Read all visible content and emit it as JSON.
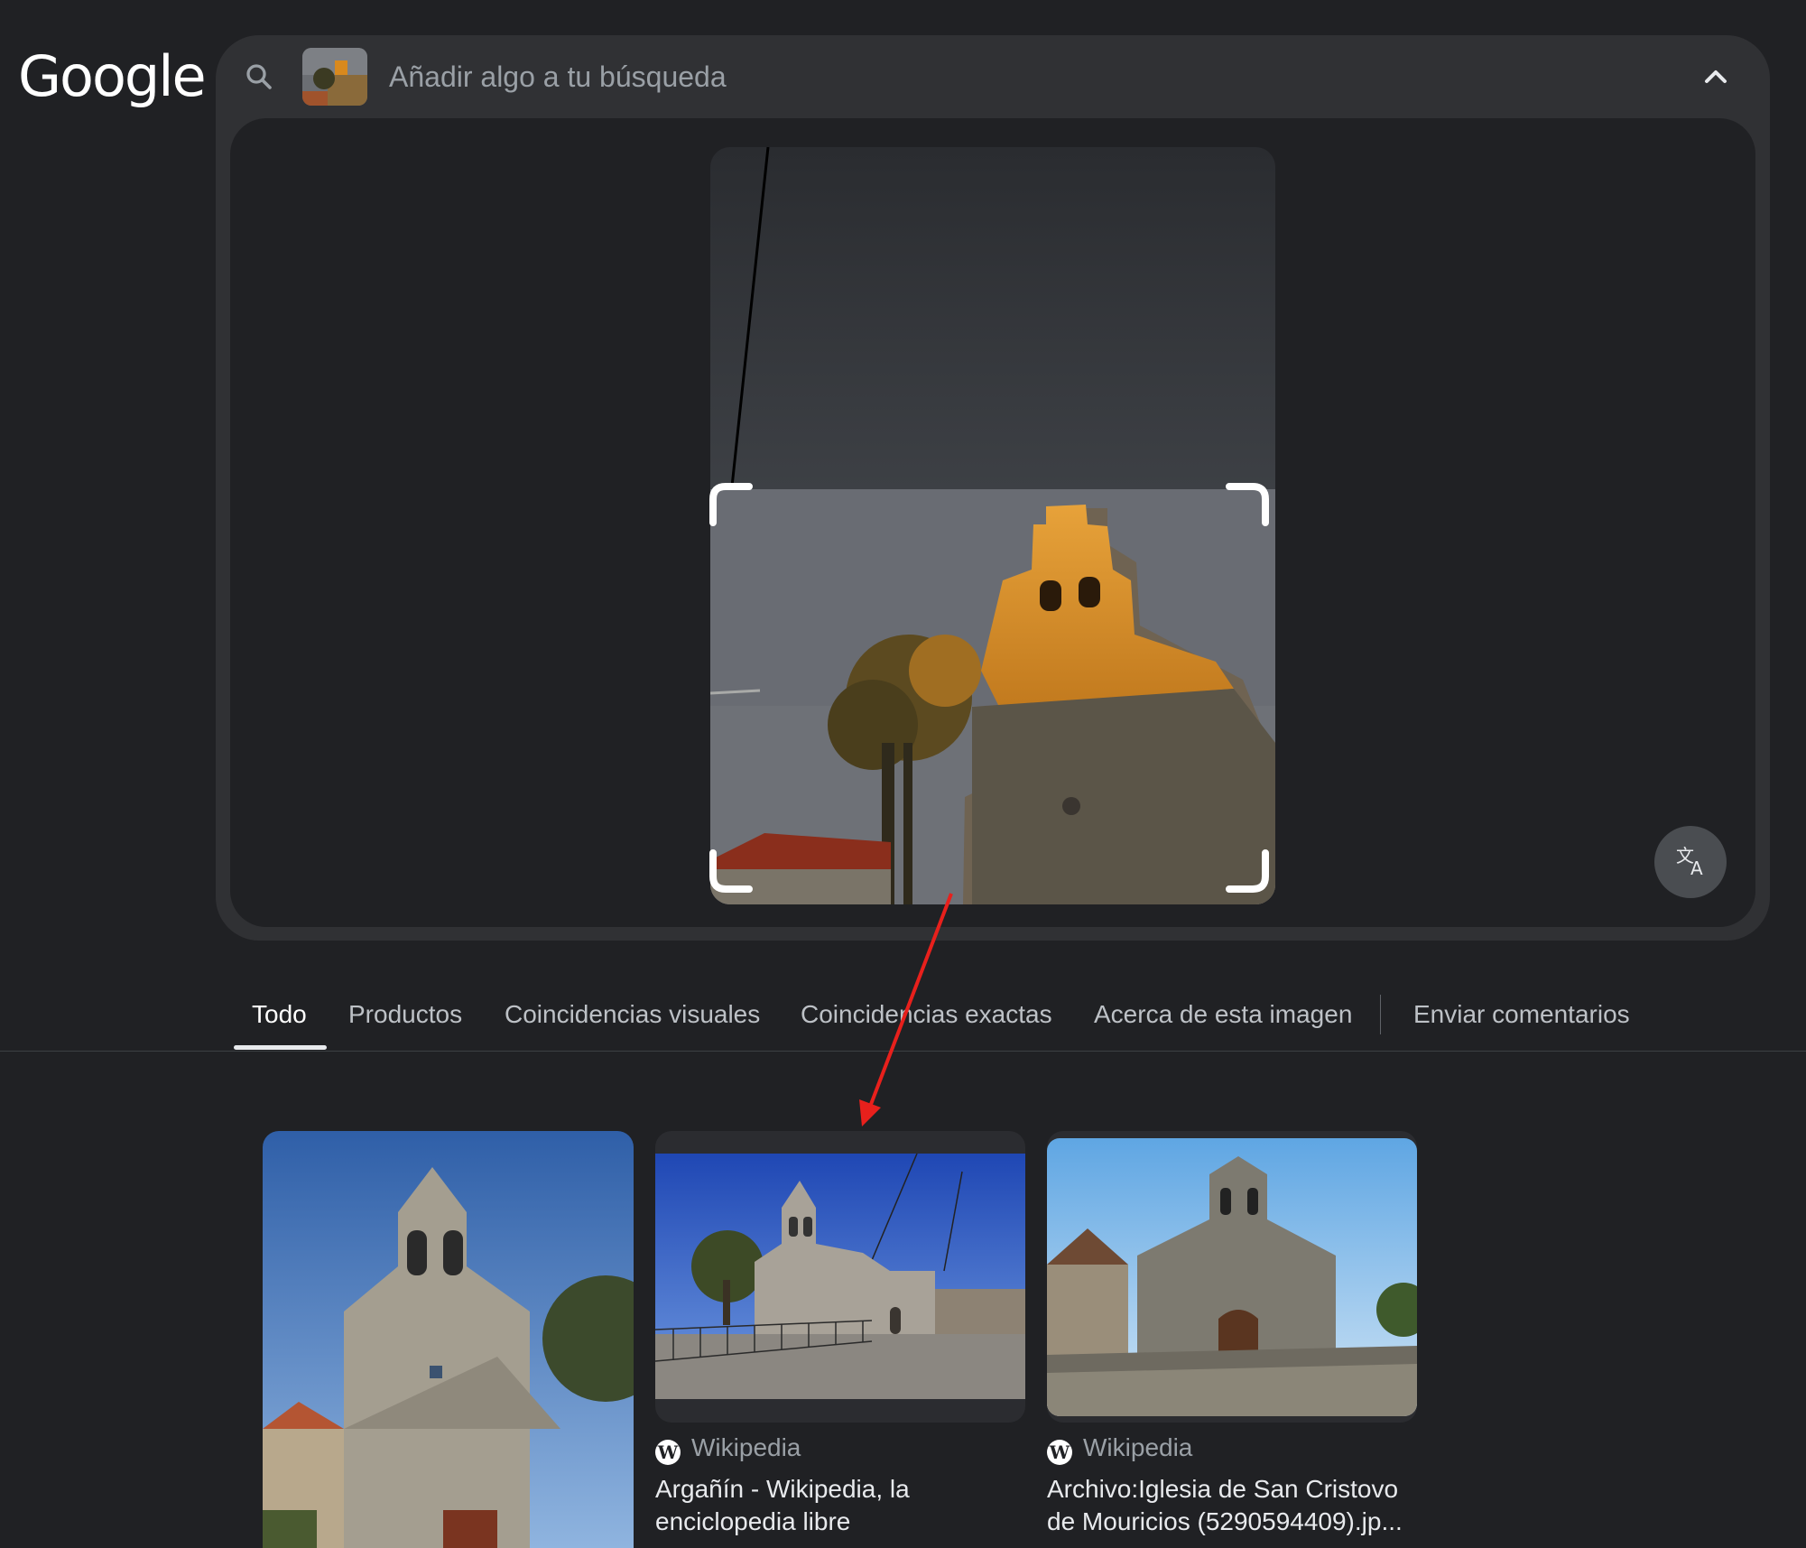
{
  "logo": "Google",
  "search": {
    "placeholder": "Añadir algo a tu búsqueda"
  },
  "tabs": [
    {
      "label": "Todo",
      "active": true
    },
    {
      "label": "Productos"
    },
    {
      "label": "Coincidencias visuales"
    },
    {
      "label": "Coincidencias exactas"
    },
    {
      "label": "Acerca de esta imagen"
    },
    {
      "label": "Enviar comentarios"
    }
  ],
  "results": [
    {
      "source": "",
      "title": ""
    },
    {
      "source": "Wikipedia",
      "title": "Argañín - Wikipedia, la enciclopedia libre"
    },
    {
      "source": "Wikipedia",
      "title": "Archivo:Iglesia de San Cristovo de Mouricios (5290594409).jp..."
    }
  ],
  "icons": {
    "search": "search-icon",
    "collapse": "chevron-up-icon",
    "translate": "translate-icon",
    "source": "wikipedia-icon"
  },
  "colors": {
    "background": "#202124",
    "card": "#303134",
    "annotation_arrow": "#e8201c"
  }
}
